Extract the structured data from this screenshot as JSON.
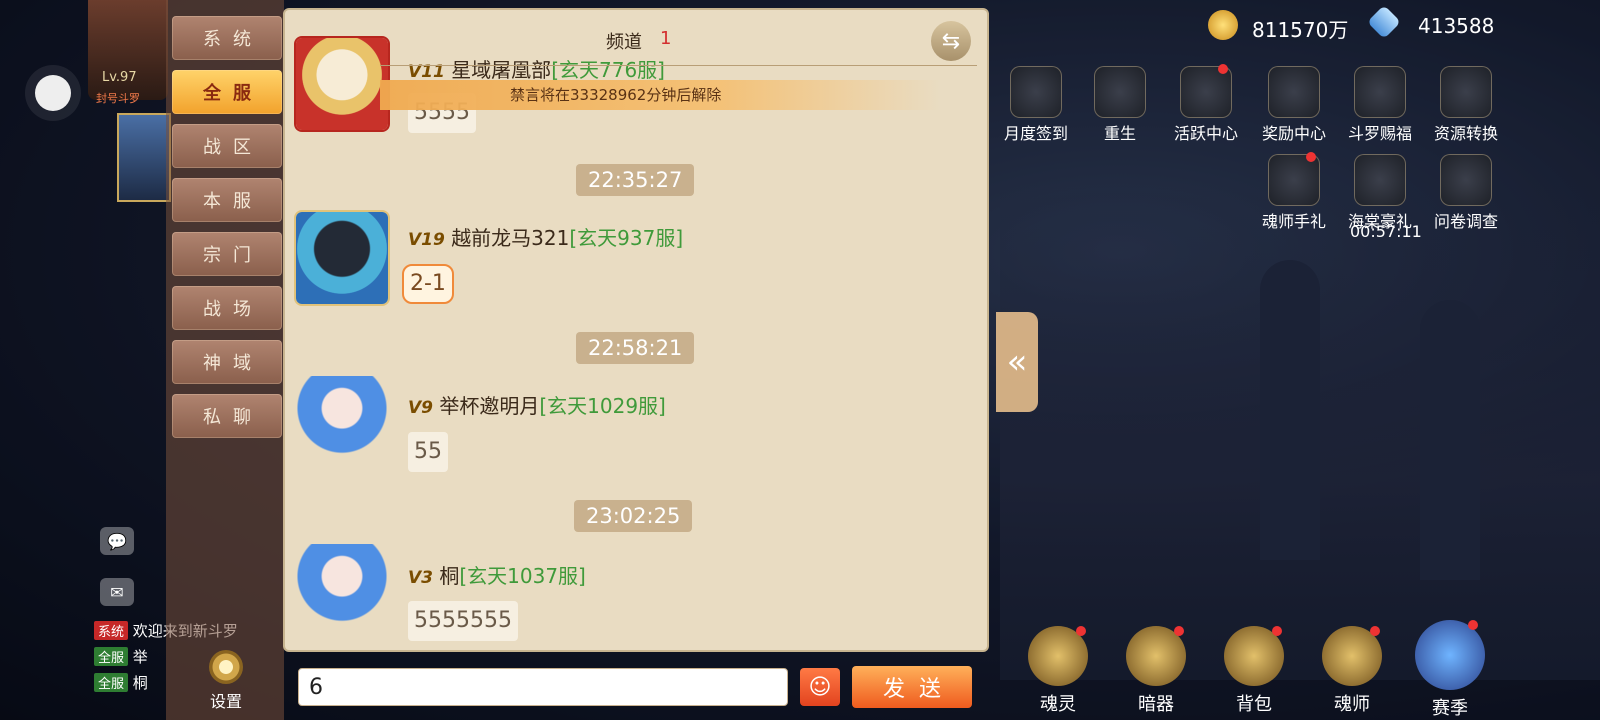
{
  "left": {
    "level": "Lv.97",
    "title_badge": "封号斗罗"
  },
  "tabs": [
    {
      "label": "系统",
      "active": false
    },
    {
      "label": "全服",
      "active": true
    },
    {
      "label": "战区",
      "active": false
    },
    {
      "label": "本服",
      "active": false
    },
    {
      "label": "宗门",
      "active": false
    },
    {
      "label": "战场",
      "active": false
    },
    {
      "label": "神域",
      "active": false
    },
    {
      "label": "私聊",
      "active": false
    }
  ],
  "settings_label": "设置",
  "chat": {
    "channel_label": "频道",
    "channel_number": "1",
    "mute_notice": "禁言将在33328962分钟后解除",
    "messages": [
      {
        "vip": "V11",
        "name": "星域屠凰部",
        "server": "[玄天776服]",
        "text": "5555"
      },
      {
        "time": "22:35:27"
      },
      {
        "vip": "V19",
        "name": "越前龙马321",
        "server": "[玄天937服]",
        "text": "2-1"
      },
      {
        "time": "22:58:21"
      },
      {
        "vip": "V9",
        "name": "举杯邀明月",
        "server": "[玄天1029服]",
        "text": "55"
      },
      {
        "time": "23:02:25"
      },
      {
        "vip": "V3",
        "name": "桐",
        "server": "[玄天1037服]",
        "text": "5555555"
      }
    ]
  },
  "input": {
    "value": "6"
  },
  "send_label": "发送",
  "currencies": {
    "gold": "811570万",
    "diamond": "413588"
  },
  "right_menu_row1": [
    "月度签到",
    "重生",
    "活跃中心",
    "奖励中心",
    "斗罗赐福",
    "资源转换"
  ],
  "right_menu_row2": [
    "魂师手礼",
    "海棠豪礼",
    "问卷调查"
  ],
  "timer": "00:57:11",
  "bottom_menu": [
    "魂灵",
    "暗器",
    "背包",
    "魂师",
    "赛季"
  ],
  "left_chat_lines": [
    {
      "tag": "系统",
      "text": "欢迎来到新斗罗"
    },
    {
      "tag": "全服",
      "text": "举"
    },
    {
      "tag": "全服",
      "text": "桐"
    }
  ],
  "colors": {
    "accent": "#f2a22c",
    "server_green": "#3f9a3a",
    "channel_red": "#d32f2f"
  }
}
